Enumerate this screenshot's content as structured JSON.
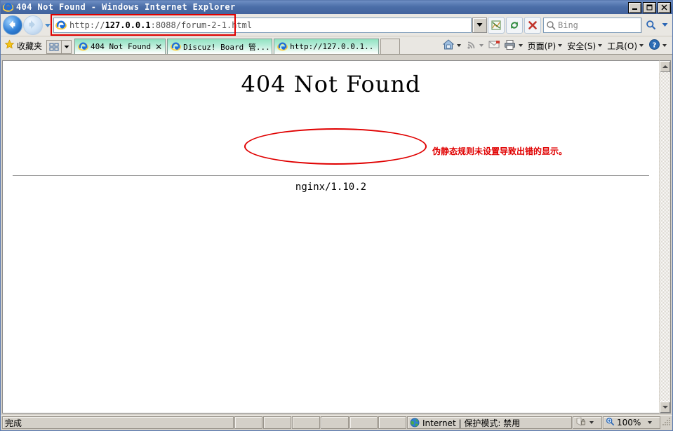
{
  "window": {
    "title": "404 Not Found - Windows Internet Explorer",
    "icon": "ie-logo-icon",
    "controls": {
      "minimize": "_",
      "maximize": "❐",
      "close": "✕"
    }
  },
  "toolbar": {
    "back_icon": "back-arrow-icon",
    "forward_icon": "forward-arrow-icon",
    "history_dropdown_icon": "chevron-down-icon",
    "address": {
      "icon": "ie-logo-icon",
      "scheme": "http://",
      "host": "127.0.0.1",
      "rest": ":8088/forum-2-1.html",
      "full_value": "http://127.0.0.1:8088/forum-2-1.html",
      "placeholder": "http://",
      "dropdown_icon": "chevron-down-icon",
      "highlight_color": "#e00000"
    },
    "compat_view_icon": "compatibility-view-icon",
    "refresh_icon": "refresh-icon",
    "stop_icon": "stop-icon",
    "search": {
      "icon": "magnifier-icon",
      "value": "Bing",
      "placeholder": "Bing",
      "go_icon": "magnifier-icon",
      "dropdown_icon": "chevron-down-icon"
    }
  },
  "favorites": {
    "star_icon": "star-icon",
    "label": "收藏夹",
    "quick_tabs_icon": "quick-tabs-icon",
    "quick_tabs_dropdown_icon": "chevron-down-icon"
  },
  "tabs": [
    {
      "label": "404 Not Found",
      "icon": "ie-logo-icon",
      "active": true,
      "close": "✕"
    },
    {
      "label": "Discuz! Board 管...",
      "icon": "ie-logo-icon",
      "active": false,
      "close": ""
    },
    {
      "label": "http://127.0.0.1...",
      "icon": "ie-logo-icon",
      "active": false,
      "close": ""
    }
  ],
  "new_tab": {
    "name": "new-tab-button",
    "label": ""
  },
  "command_bar": [
    {
      "label": "",
      "icon": "home-icon",
      "dropdown": true
    },
    {
      "label": "",
      "icon": "rss-feed-icon",
      "dropdown": true,
      "disabled": true
    },
    {
      "label": "",
      "icon": "mail-icon",
      "dropdown": false
    },
    {
      "label": "",
      "icon": "print-icon",
      "dropdown": true
    },
    {
      "label": "页面(P)",
      "icon": "",
      "dropdown": true
    },
    {
      "label": "安全(S)",
      "icon": "",
      "dropdown": true
    },
    {
      "label": "工具(O)",
      "icon": "",
      "dropdown": true
    },
    {
      "label": "",
      "icon": "help-icon",
      "dropdown": true
    }
  ],
  "page": {
    "heading": "404 Not Found",
    "server": "nginx/1.10.2",
    "annotation": "伪静态规则未设置导致出错的显示。",
    "annotation_color": "#e00000",
    "ellipse_annotation": "red-ellipse-annotation"
  },
  "scrollbar": {
    "up_icon": "scroll-up-arrow-icon",
    "down_icon": "scroll-down-arrow-icon"
  },
  "status_bar": {
    "message": "完成",
    "empty_cells": 6,
    "zone_icon": "internet-zone-icon",
    "zone": "Internet  |  保护模式: 禁用",
    "privacy_icon": "privacy-report-icon",
    "privacy_dropdown_icon": "chevron-down-icon",
    "zoom_icon": "zoom-icon",
    "zoom": "100%",
    "zoom_dropdown_icon": "chevron-down-icon",
    "resize_grip_icon": "resize-grip-icon"
  }
}
